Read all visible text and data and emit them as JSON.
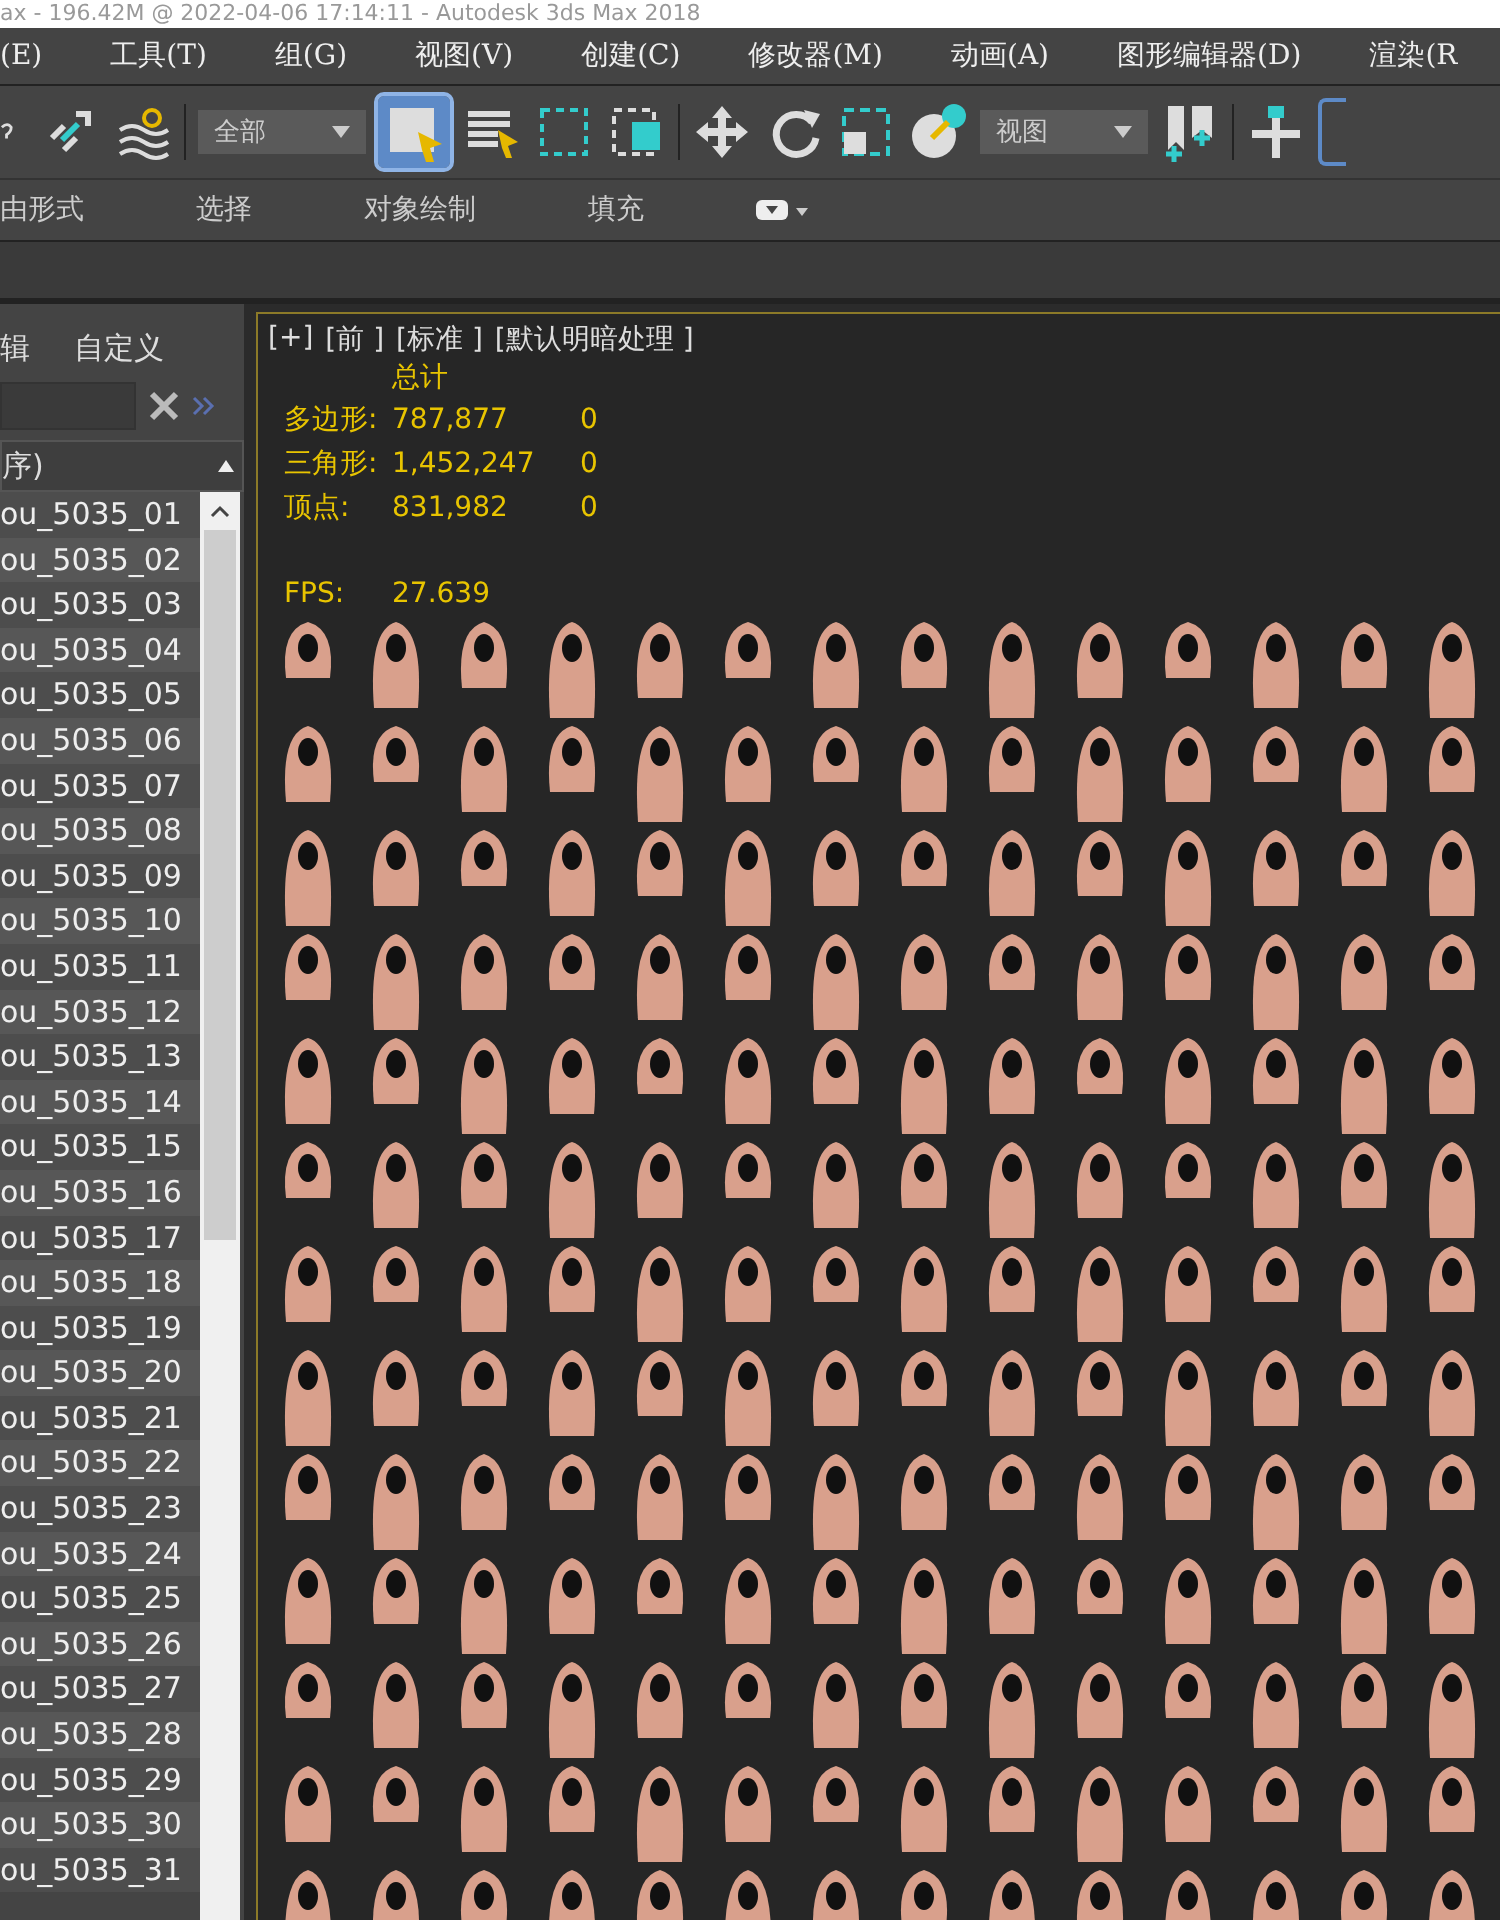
{
  "window": {
    "title": "ax - 196.42M @ 2022-04-06 17:14:11 - Autodesk 3ds Max 2018"
  },
  "menu": [
    "(E)",
    "工具(T)",
    "组(G)",
    "视图(V)",
    "创建(C)",
    "修改器(M)",
    "动画(A)",
    "图形编辑器(D)",
    "渲染(R"
  ],
  "toolbar": {
    "selection_filter": "全部",
    "select_object_active": true,
    "reference_coord": "视图"
  },
  "ribbon_tabs": [
    "由形式",
    "选择",
    "对象绘制",
    "填充"
  ],
  "scene_explorer": {
    "menu": [
      "辑",
      "自定义"
    ],
    "column_header": "序)",
    "items": [
      "ou_5035_01",
      "ou_5035_02",
      "ou_5035_03",
      "ou_5035_04",
      "ou_5035_05",
      "ou_5035_06",
      "ou_5035_07",
      "ou_5035_08",
      "ou_5035_09",
      "ou_5035_10",
      "ou_5035_11",
      "ou_5035_12",
      "ou_5035_13",
      "ou_5035_14",
      "ou_5035_15",
      "ou_5035_16",
      "ou_5035_17",
      "ou_5035_18",
      "ou_5035_19",
      "ou_5035_20",
      "ou_5035_21",
      "ou_5035_22",
      "ou_5035_23",
      "ou_5035_24",
      "ou_5035_25",
      "ou_5035_26",
      "ou_5035_27",
      "ou_5035_28",
      "ou_5035_29",
      "ou_5035_30",
      "ou_5035_31"
    ]
  },
  "viewport": {
    "labels": [
      "[+]",
      "[前 ]",
      "[标准 ]",
      "[默认明暗处理 ]"
    ],
    "stats_header": "总计",
    "stats": [
      {
        "label": "多边形:",
        "total": "787,877",
        "selected": "0"
      },
      {
        "label": "三角形:",
        "total": "1,452,247",
        "selected": "0"
      },
      {
        "label": "顶点:",
        "total": "831,982",
        "selected": "0"
      }
    ],
    "fps_label": "FPS:",
    "fps": "27.639"
  }
}
